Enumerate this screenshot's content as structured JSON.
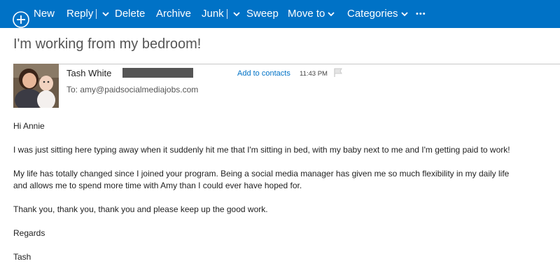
{
  "toolbar": {
    "new_label": "New",
    "reply_label": "Reply",
    "delete_label": "Delete",
    "archive_label": "Archive",
    "junk_label": "Junk",
    "sweep_label": "Sweep",
    "moveto_label": "Move to",
    "categories_label": "Categories",
    "more_label": "•••",
    "bg_color": "#0072c6"
  },
  "message": {
    "subject": "I'm working from my bedroom!",
    "sender_name": "Tash White",
    "add_contacts": "Add to contacts",
    "time": "11:43 PM",
    "to": "To: amy@paidsocialmediajobs.com",
    "paragraphs": [
      "Hi Annie",
      "I was just sitting here typing away when it suddenly hit me that I'm sitting in bed, with my baby next to me and I'm getting paid to work!",
      "My life has totally changed since I joined your program. Being a social media manager has given me so much flexibility in my daily life and allows me to spend more time with Amy than I could ever have hoped for.",
      "Thank you, thank you, thank you and please keep up the good work.",
      "Regards",
      "Tash"
    ]
  }
}
